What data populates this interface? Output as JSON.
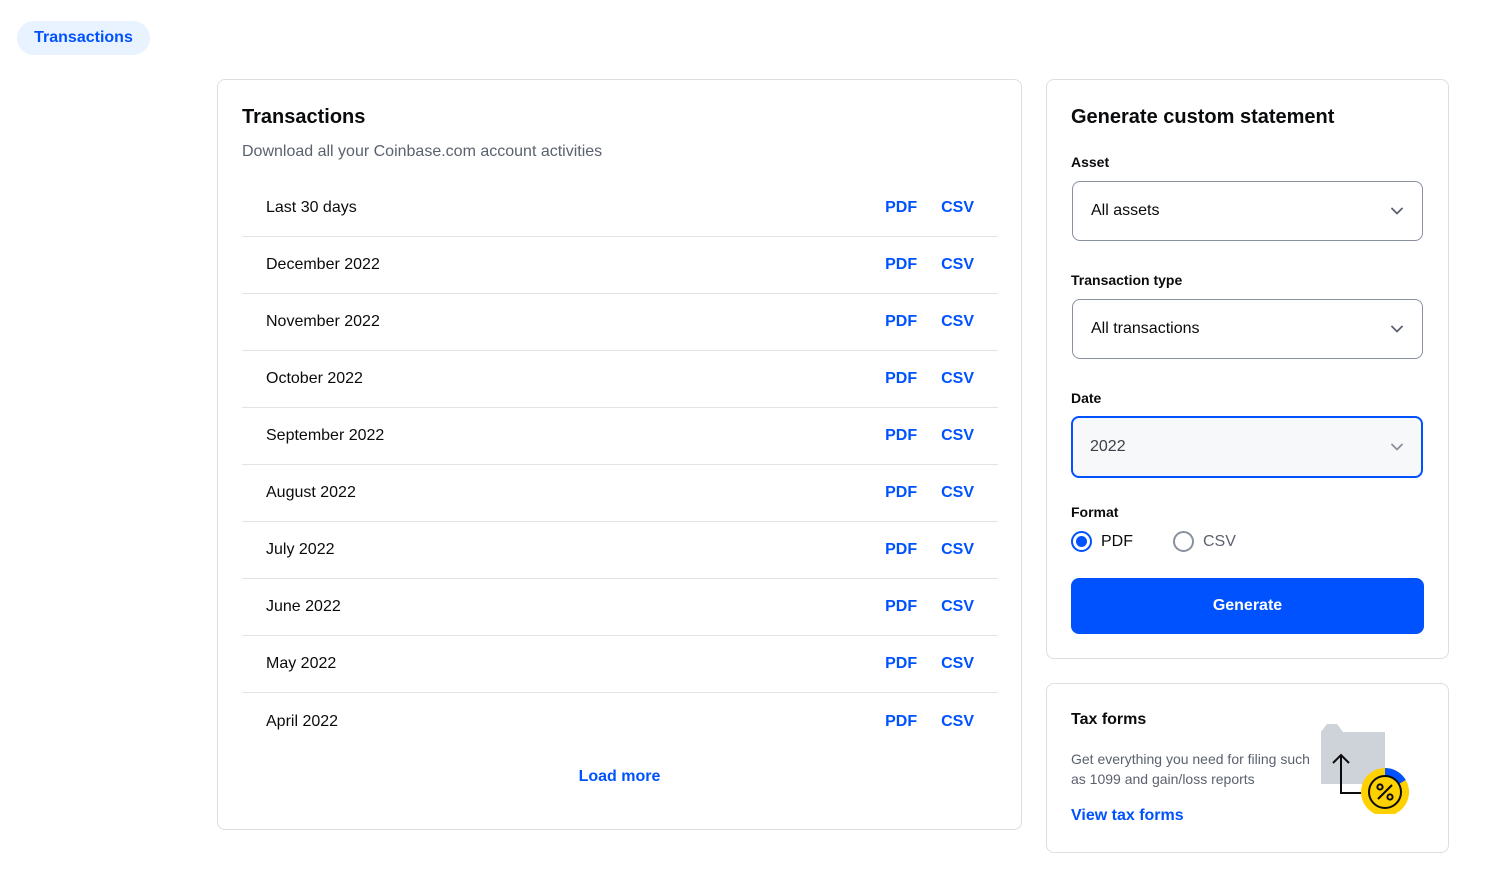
{
  "nav": {
    "active_tab": "Transactions"
  },
  "transactions": {
    "title": "Transactions",
    "subtitle": "Download all your Coinbase.com account activities",
    "rows": [
      {
        "label": "Last 30 days",
        "pdf": "PDF",
        "csv": "CSV"
      },
      {
        "label": "December 2022",
        "pdf": "PDF",
        "csv": "CSV"
      },
      {
        "label": "November 2022",
        "pdf": "PDF",
        "csv": "CSV"
      },
      {
        "label": "October 2022",
        "pdf": "PDF",
        "csv": "CSV"
      },
      {
        "label": "September 2022",
        "pdf": "PDF",
        "csv": "CSV"
      },
      {
        "label": "August 2022",
        "pdf": "PDF",
        "csv": "CSV"
      },
      {
        "label": "July 2022",
        "pdf": "PDF",
        "csv": "CSV"
      },
      {
        "label": "June 2022",
        "pdf": "PDF",
        "csv": "CSV"
      },
      {
        "label": "May 2022",
        "pdf": "PDF",
        "csv": "CSV"
      },
      {
        "label": "April 2022",
        "pdf": "PDF",
        "csv": "CSV"
      }
    ],
    "load_more": "Load more"
  },
  "statement": {
    "title": "Generate custom statement",
    "asset": {
      "label": "Asset",
      "value": "All assets"
    },
    "transaction_type": {
      "label": "Transaction type",
      "value": "All transactions"
    },
    "date": {
      "label": "Date",
      "value": "2022"
    },
    "format": {
      "label": "Format",
      "options": [
        {
          "label": "PDF",
          "checked": true
        },
        {
          "label": "CSV",
          "checked": false
        }
      ]
    },
    "generate_label": "Generate"
  },
  "tax": {
    "title": "Tax forms",
    "description": "Get everything you need for filing such as 1099 and gain/loss reports",
    "link": "View tax forms",
    "illustration": "folder-upload-percent-icon"
  },
  "colors": {
    "accent": "#0052ff",
    "pill_bg": "#e8f3ff",
    "muted_text": "#5b616e",
    "badge_yellow": "#ffd100",
    "folder_gray": "#ced2d9"
  }
}
